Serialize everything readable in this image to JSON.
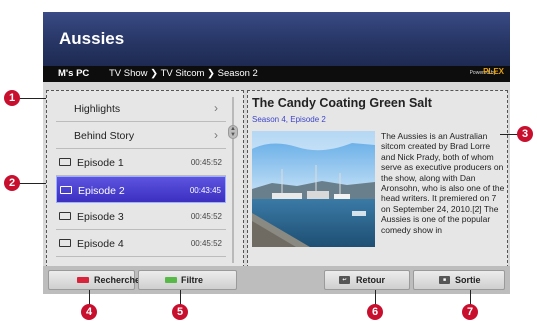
{
  "header": {
    "title": "Aussies"
  },
  "crumbbar": {
    "source": "M's PC",
    "path": "TV Show ❯ TV Sitcom ❯ Season 2",
    "powered_by": "Powered by",
    "brand": "PLEX"
  },
  "list": {
    "folders": [
      {
        "label": "Highlights",
        "chevron": "›"
      },
      {
        "label": "Behind Story",
        "chevron": "›"
      }
    ],
    "episodes": [
      {
        "label": "Episode 1",
        "time": "00:45:52"
      },
      {
        "label": "Episode 2",
        "time": "00:43:45"
      },
      {
        "label": "Episode 3",
        "time": "00:45:52"
      },
      {
        "label": "Episode 4",
        "time": "00:45:52"
      }
    ],
    "selected_index": 1
  },
  "detail": {
    "title": "The Candy Coating Green Salt",
    "subtitle": "Season 4, Episode 2",
    "description": "The Aussies is an Australian sitcom created by Brad Lorre and Nick Prady, both of whom serve as executive producers on the show, along with Dan Aronsohn, who is also one of the head writers. It premiered on 7 on September 24, 2010.[2] The Aussies is one of the popular comedy show in"
  },
  "footer": {
    "search_label": "Recherche",
    "filter_label": "Filtre",
    "back_label": "Retour",
    "exit_label": "Sortie",
    "search_key_color": "#d9233a",
    "filter_key_color": "#58b948"
  },
  "callouts": [
    "1",
    "2",
    "3",
    "4",
    "5",
    "6",
    "7"
  ],
  "colors": {
    "header": "#273665",
    "selection": "#4a40d6",
    "subtitle": "#3d45c9",
    "callout": "#c8102e"
  }
}
